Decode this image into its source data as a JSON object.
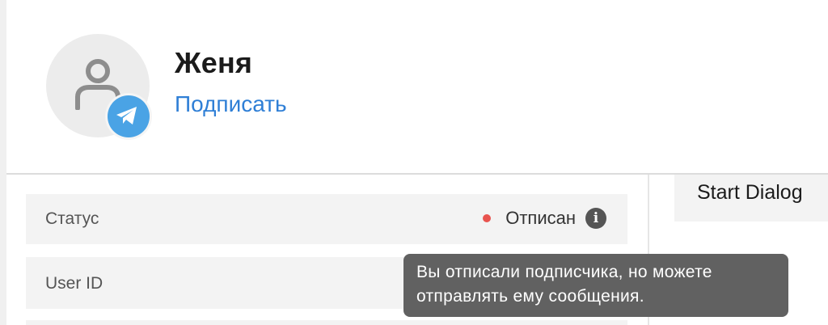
{
  "profile": {
    "name": "Женя",
    "subscribe_link": "Подписать",
    "avatar_icon": "person-icon",
    "badge_icon": "telegram-icon",
    "badge_color": "#4aa3e5"
  },
  "info_rows": {
    "status": {
      "label": "Статус",
      "value": "Отписан",
      "dot_color": "#e8534e",
      "info_icon": "info-icon"
    },
    "user_id": {
      "label": "User ID"
    }
  },
  "actions": {
    "start_dialog_label": "Start Dialog"
  },
  "tooltip": {
    "text": "Вы отписали подписчика, но можете отправлять ему сообщения."
  }
}
